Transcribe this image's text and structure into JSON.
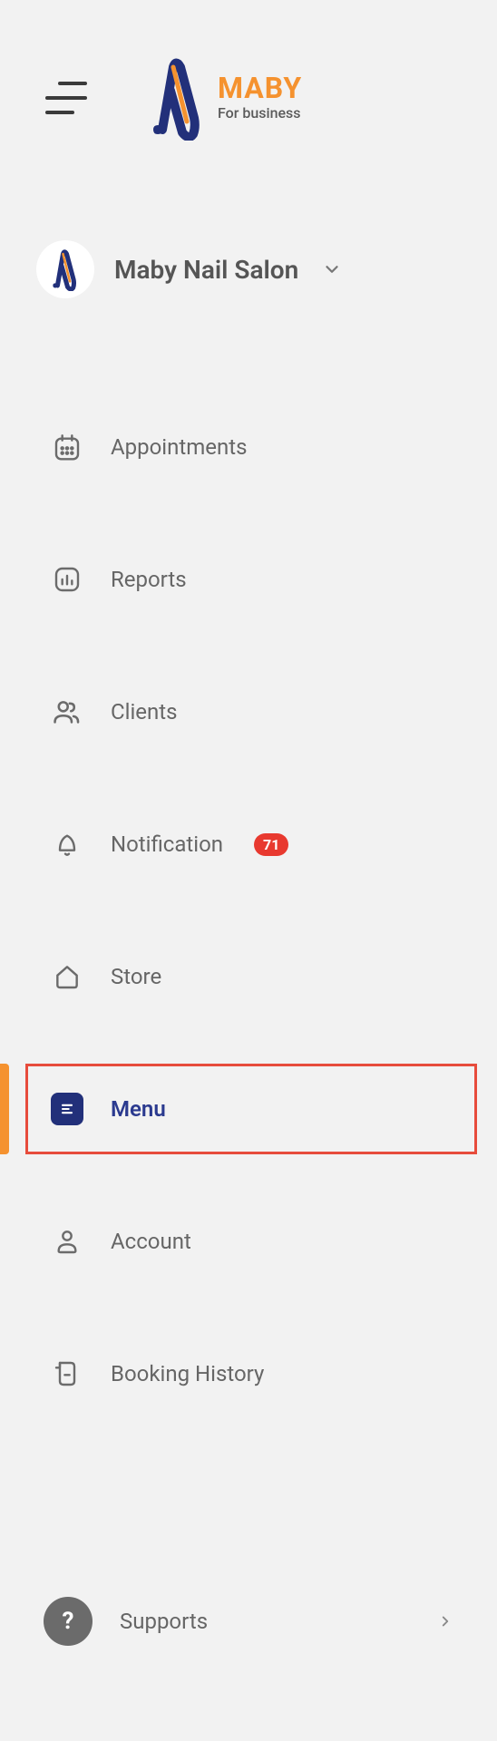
{
  "brand": {
    "name": "MABY",
    "subtitle": "For business"
  },
  "salon": {
    "name": "Maby Nail Salon"
  },
  "nav": {
    "items": [
      {
        "label": "Appointments"
      },
      {
        "label": "Reports"
      },
      {
        "label": "Clients"
      },
      {
        "label": "Notification",
        "badge": "71"
      },
      {
        "label": "Store"
      },
      {
        "label": "Menu"
      },
      {
        "label": "Account"
      },
      {
        "label": "Booking History"
      }
    ]
  },
  "footer": {
    "label": "Supports"
  }
}
